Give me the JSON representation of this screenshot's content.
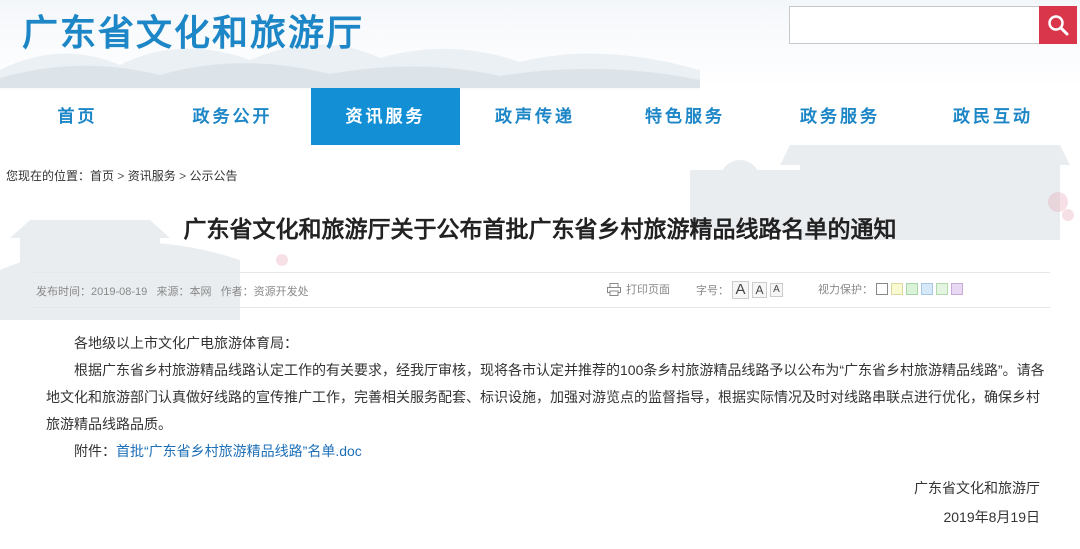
{
  "header": {
    "site_title": "广东省文化和旅游厅",
    "search_placeholder": "",
    "search_icon": "search-icon",
    "brand_color": "#1d86c6",
    "search_button_color": "#d9364b"
  },
  "nav": {
    "items": [
      {
        "label": "首页",
        "active": false
      },
      {
        "label": "政务公开",
        "active": false
      },
      {
        "label": "资讯服务",
        "active": true
      },
      {
        "label": "政声传递",
        "active": false
      },
      {
        "label": "特色服务",
        "active": false
      },
      {
        "label": "政务服务",
        "active": false
      },
      {
        "label": "政民互动",
        "active": false
      }
    ],
    "active_color": "#138fd6"
  },
  "breadcrumb": {
    "prefix": "您现在的位置：",
    "items": [
      "首页",
      "资讯服务",
      "公示公告"
    ],
    "separator": ">"
  },
  "article": {
    "title": "广东省文化和旅游厅关于公布首批广东省乡村旅游精品线路名单的通知",
    "meta": {
      "date_label": "发布时间：",
      "date": "2019-08-19",
      "source_label": "来源：",
      "source": "本网",
      "author_label": "作者：",
      "author": "资源开发处"
    },
    "tools": {
      "print": "打印页面",
      "font_size_label": "字号：",
      "font_sizes": [
        "A",
        "A",
        "A"
      ],
      "vision_label": "视力保护：",
      "vision_colors": [
        "#ffffff",
        "#fafad2",
        "#d9f2d9",
        "#d6e9f8",
        "#e3f5e1",
        "#ead9f2"
      ]
    },
    "salutation": "各地级以上市文化广电旅游体育局：",
    "body": "根据广东省乡村旅游精品线路认定工作的有关要求，经我厅审核，现将各市认定并推荐的100条乡村旅游精品线路予以公布为“广东省乡村旅游精品线路”。请各地文化和旅游部门认真做好线路的宣传推广工作，完善相关服务配套、标识设施，加强对游览点的监督指导，根据实际情况及时对线路串联点进行优化，确保乡村旅游精品线路品质。",
    "attachment_label": "附件：",
    "attachment_link": "首批“广东省乡村旅游精品线路”名单.doc",
    "signature": "广东省文化和旅游厅",
    "signed_date": "2019年8月19日"
  }
}
